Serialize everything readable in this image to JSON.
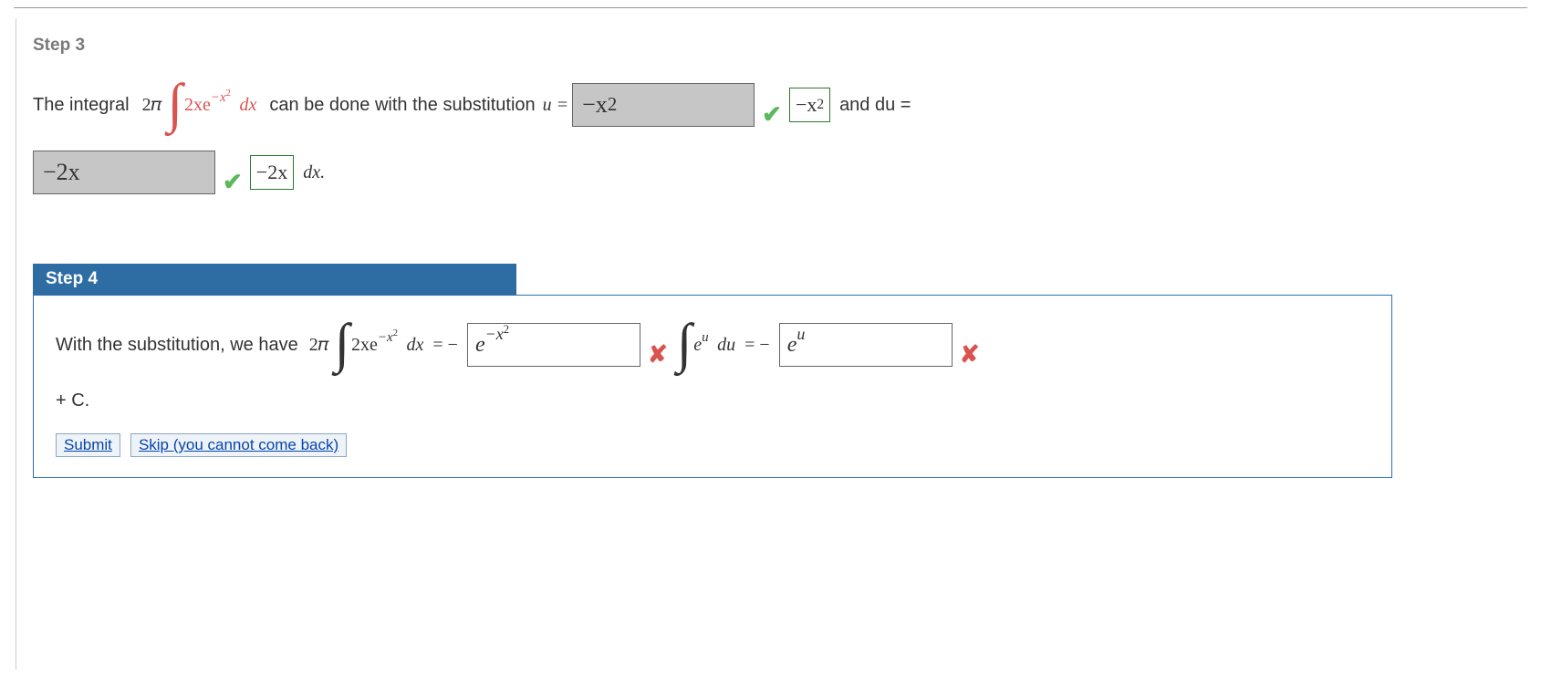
{
  "step3": {
    "header": "Step 3",
    "text_prefix": "The integral",
    "two_pi": "2𝜋",
    "integrand_txt": "2xe",
    "integrand_exp_pre": "−x",
    "integrand_exp_sup": "2",
    "dx": "dx",
    "text_mid": "can be done with the substitution",
    "u_eq": "u =",
    "answer_u_display": "−x",
    "answer_u_sup": "2",
    "tag_u_display": "−x",
    "tag_u_sup": "2",
    "and_du": "and du =",
    "answer_du_display": "−2x",
    "tag_du_display": "−2x",
    "dx_after": "dx."
  },
  "step4": {
    "header": "Step 4",
    "text_prefix": "With the substitution, we have",
    "two_pi": "2𝜋",
    "integrand_txt": "2xe",
    "integrand_exp_pre": "−x",
    "integrand_exp_sup": "2",
    "dx": "dx",
    "eq_neg": "= −",
    "answer1_base": "e",
    "answer1_exp_pre": "−x",
    "answer1_exp_sup": "2",
    "int2_base": "e",
    "int2_sup": "u",
    "int2_du": "du",
    "eq_neg2": "= −",
    "answer2_base": "e",
    "answer2_sup": "u",
    "plus_c": "+ C.",
    "submit": "Submit",
    "skip": "Skip (you cannot come back)"
  },
  "icons": {
    "check": "✔",
    "cross": "✘"
  }
}
